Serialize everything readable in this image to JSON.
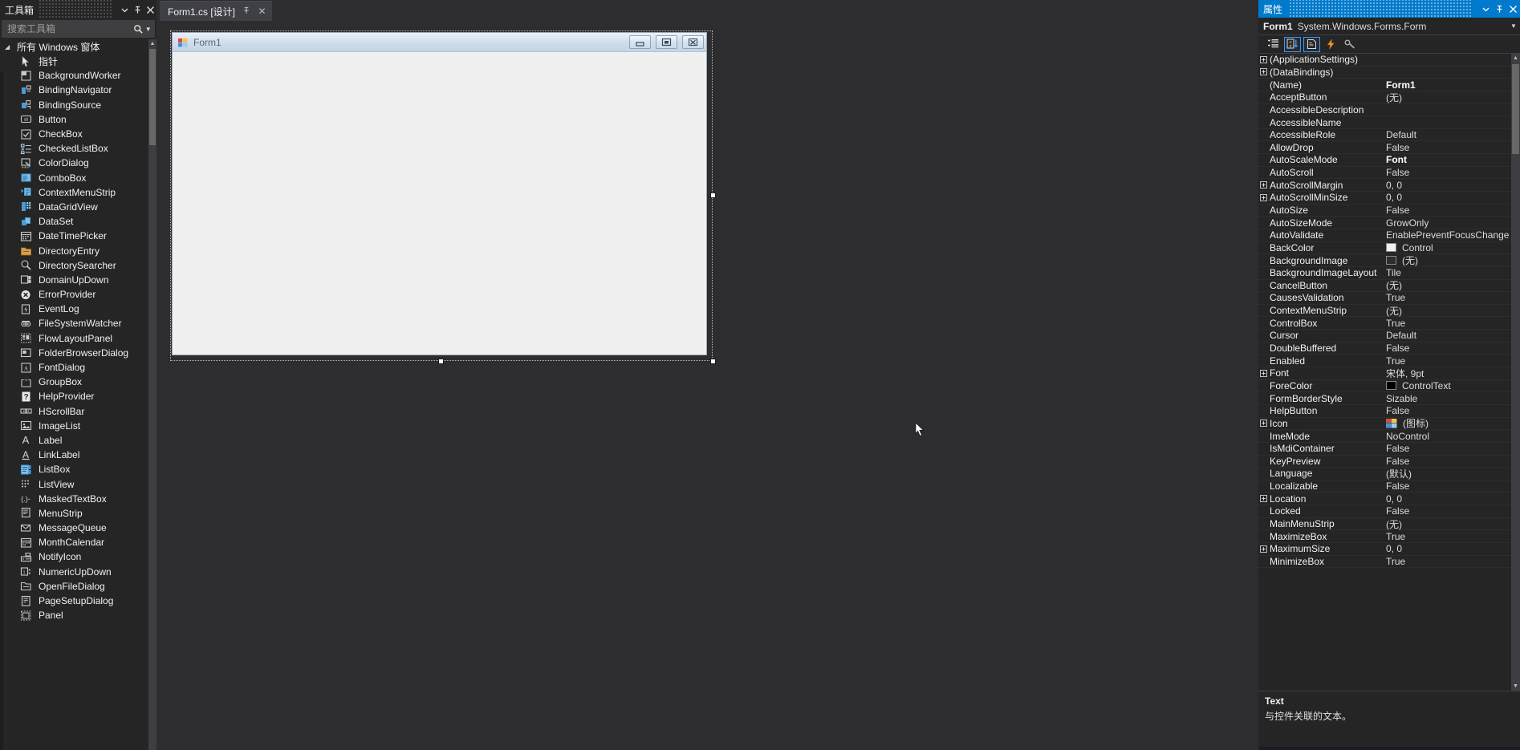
{
  "toolbox": {
    "title": "工具箱",
    "dropdown_icon": "chevron-down-icon",
    "pin_icon": "pin-icon",
    "close_icon": "close-icon",
    "search_placeholder": "搜索工具箱",
    "search_value": "",
    "search_icon": "search-icon",
    "group_label": "所有 Windows 窗体",
    "items": [
      {
        "label": "指针",
        "icon": "pointer-icon"
      },
      {
        "label": "BackgroundWorker",
        "icon": "backgroundworker-icon"
      },
      {
        "label": "BindingNavigator",
        "icon": "bindingnavigator-icon"
      },
      {
        "label": "BindingSource",
        "icon": "bindingsource-icon"
      },
      {
        "label": "Button",
        "icon": "button-icon"
      },
      {
        "label": "CheckBox",
        "icon": "checkbox-icon"
      },
      {
        "label": "CheckedListBox",
        "icon": "checkedlistbox-icon"
      },
      {
        "label": "ColorDialog",
        "icon": "colordialog-icon"
      },
      {
        "label": "ComboBox",
        "icon": "combobox-icon"
      },
      {
        "label": "ContextMenuStrip",
        "icon": "contextmenustrip-icon"
      },
      {
        "label": "DataGridView",
        "icon": "datagridview-icon"
      },
      {
        "label": "DataSet",
        "icon": "dataset-icon"
      },
      {
        "label": "DateTimePicker",
        "icon": "datetimepicker-icon"
      },
      {
        "label": "DirectoryEntry",
        "icon": "directoryentry-icon"
      },
      {
        "label": "DirectorySearcher",
        "icon": "directorysearcher-icon"
      },
      {
        "label": "DomainUpDown",
        "icon": "domainupdown-icon"
      },
      {
        "label": "ErrorProvider",
        "icon": "errorprovider-icon"
      },
      {
        "label": "EventLog",
        "icon": "eventlog-icon"
      },
      {
        "label": "FileSystemWatcher",
        "icon": "filesystemwatcher-icon"
      },
      {
        "label": "FlowLayoutPanel",
        "icon": "flowlayoutpanel-icon"
      },
      {
        "label": "FolderBrowserDialog",
        "icon": "folderbrowserdialog-icon"
      },
      {
        "label": "FontDialog",
        "icon": "fontdialog-icon"
      },
      {
        "label": "GroupBox",
        "icon": "groupbox-icon"
      },
      {
        "label": "HelpProvider",
        "icon": "helpprovider-icon"
      },
      {
        "label": "HScrollBar",
        "icon": "hscrollbar-icon"
      },
      {
        "label": "ImageList",
        "icon": "imagelist-icon"
      },
      {
        "label": "Label",
        "icon": "label-icon"
      },
      {
        "label": "LinkLabel",
        "icon": "linklabel-icon"
      },
      {
        "label": "ListBox",
        "icon": "listbox-icon"
      },
      {
        "label": "ListView",
        "icon": "listview-icon"
      },
      {
        "label": "MaskedTextBox",
        "icon": "maskedtextbox-icon"
      },
      {
        "label": "MenuStrip",
        "icon": "menustrip-icon"
      },
      {
        "label": "MessageQueue",
        "icon": "messagequeue-icon"
      },
      {
        "label": "MonthCalendar",
        "icon": "monthcalendar-icon"
      },
      {
        "label": "NotifyIcon",
        "icon": "notifyicon-icon"
      },
      {
        "label": "NumericUpDown",
        "icon": "numericupdown-icon"
      },
      {
        "label": "OpenFileDialog",
        "icon": "openfiledialog-icon"
      },
      {
        "label": "PageSetupDialog",
        "icon": "pagesetupdialog-icon"
      },
      {
        "label": "Panel",
        "icon": "panel-icon"
      }
    ]
  },
  "designer": {
    "tab_label": "Form1.cs [设计]",
    "tab_pin_icon": "pin-icon",
    "tab_close_icon": "close-icon",
    "form": {
      "title": "Form1",
      "icon": "form-icon",
      "minimize_label": "minimize-icon",
      "maximize_label": "maximize-icon",
      "close_label": "close-icon"
    },
    "cursor_icon": "mouse-pointer-icon"
  },
  "properties": {
    "title": "属性",
    "dropdown_icon": "chevron-down-icon",
    "pin_icon": "pin-icon",
    "close_icon": "close-icon",
    "object_name": "Form1",
    "object_type": "System.Windows.Forms.Form",
    "toolbar": [
      {
        "name": "categorized-icon",
        "active": false
      },
      {
        "name": "alphabetical-sort-icon",
        "active": true
      },
      {
        "name": "properties-page-icon",
        "active": true
      },
      {
        "name": "events-lightning-icon",
        "active": false
      },
      {
        "name": "property-pages-key-icon",
        "active": false
      }
    ],
    "rows": [
      {
        "key": "(ApplicationSettings)",
        "value": "",
        "expandable": true
      },
      {
        "key": "(DataBindings)",
        "value": "",
        "expandable": true
      },
      {
        "key": "(Name)",
        "value": "Form1",
        "bold": true
      },
      {
        "key": "AcceptButton",
        "value": "(无)"
      },
      {
        "key": "AccessibleDescription",
        "value": ""
      },
      {
        "key": "AccessibleName",
        "value": ""
      },
      {
        "key": "AccessibleRole",
        "value": "Default"
      },
      {
        "key": "AllowDrop",
        "value": "False"
      },
      {
        "key": "AutoScaleMode",
        "value": "Font",
        "bold": true
      },
      {
        "key": "AutoScroll",
        "value": "False"
      },
      {
        "key": "AutoScrollMargin",
        "value": "0, 0",
        "expandable": true
      },
      {
        "key": "AutoScrollMinSize",
        "value": "0, 0",
        "expandable": true
      },
      {
        "key": "AutoSize",
        "value": "False"
      },
      {
        "key": "AutoSizeMode",
        "value": "GrowOnly"
      },
      {
        "key": "AutoValidate",
        "value": "EnablePreventFocusChange"
      },
      {
        "key": "BackColor",
        "value": "Control",
        "swatch": "#f0f0f0"
      },
      {
        "key": "BackgroundImage",
        "value": "(无)",
        "swatch": "#2d2d30"
      },
      {
        "key": "BackgroundImageLayout",
        "value": "Tile"
      },
      {
        "key": "CancelButton",
        "value": "(无)"
      },
      {
        "key": "CausesValidation",
        "value": "True"
      },
      {
        "key": "ContextMenuStrip",
        "value": "(无)"
      },
      {
        "key": "ControlBox",
        "value": "True"
      },
      {
        "key": "Cursor",
        "value": "Default"
      },
      {
        "key": "DoubleBuffered",
        "value": "False"
      },
      {
        "key": "Enabled",
        "value": "True"
      },
      {
        "key": "Font",
        "value": "宋体, 9pt",
        "expandable": true
      },
      {
        "key": "ForeColor",
        "value": "ControlText",
        "swatch": "#000000"
      },
      {
        "key": "FormBorderStyle",
        "value": "Sizable"
      },
      {
        "key": "HelpButton",
        "value": "False"
      },
      {
        "key": "Icon",
        "value": "(图标)",
        "expandable": true,
        "icon_swatch": true
      },
      {
        "key": "ImeMode",
        "value": "NoControl"
      },
      {
        "key": "IsMdiContainer",
        "value": "False"
      },
      {
        "key": "KeyPreview",
        "value": "False"
      },
      {
        "key": "Language",
        "value": "(默认)"
      },
      {
        "key": "Localizable",
        "value": "False"
      },
      {
        "key": "Location",
        "value": "0, 0",
        "expandable": true
      },
      {
        "key": "Locked",
        "value": "False"
      },
      {
        "key": "MainMenuStrip",
        "value": "(无)"
      },
      {
        "key": "MaximizeBox",
        "value": "True"
      },
      {
        "key": "MaximumSize",
        "value": "0, 0",
        "expandable": true
      },
      {
        "key": "MinimizeBox",
        "value": "True"
      }
    ],
    "description_title": "Text",
    "description_body": "与控件关联的文本。"
  },
  "colors": {
    "accent": "#007acc",
    "panel_bg": "#252526",
    "designer_bg": "#2d2d30",
    "text": "#f1f1f1"
  }
}
